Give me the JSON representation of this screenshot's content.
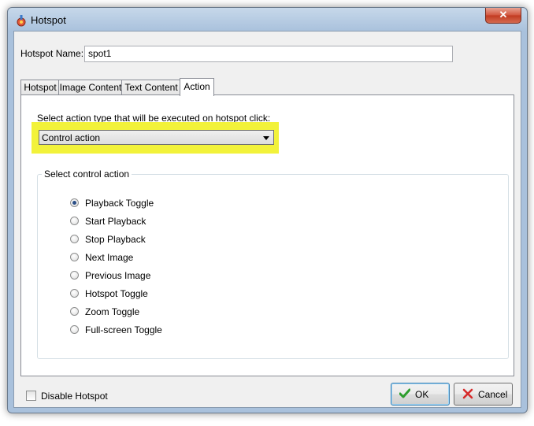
{
  "window": {
    "title": "Hotspot",
    "close_label": "✕"
  },
  "name_field": {
    "label": "Hotspot Name:",
    "value": "spot1"
  },
  "tabs": [
    {
      "label": "Hotspot"
    },
    {
      "label": "Image Content"
    },
    {
      "label": "Text Content"
    },
    {
      "label": "Action",
      "active": true
    }
  ],
  "action": {
    "prompt": "Select action type that will be executed on hotspot click:",
    "selected": "Control action",
    "highlight_color": "#f2f23a"
  },
  "control_group": {
    "legend": "Select control action",
    "options": [
      {
        "label": "Playback Toggle",
        "checked": true
      },
      {
        "label": "Start Playback",
        "checked": false
      },
      {
        "label": "Stop Playback",
        "checked": false
      },
      {
        "label": "Next Image",
        "checked": false
      },
      {
        "label": "Previous Image",
        "checked": false
      },
      {
        "label": "Hotspot Toggle",
        "checked": false
      },
      {
        "label": "Zoom Toggle",
        "checked": false
      },
      {
        "label": "Full-screen Toggle",
        "checked": false
      }
    ]
  },
  "footer": {
    "disable_label": "Disable Hotspot",
    "disable_checked": false,
    "ok_label": "OK",
    "cancel_label": "Cancel"
  }
}
